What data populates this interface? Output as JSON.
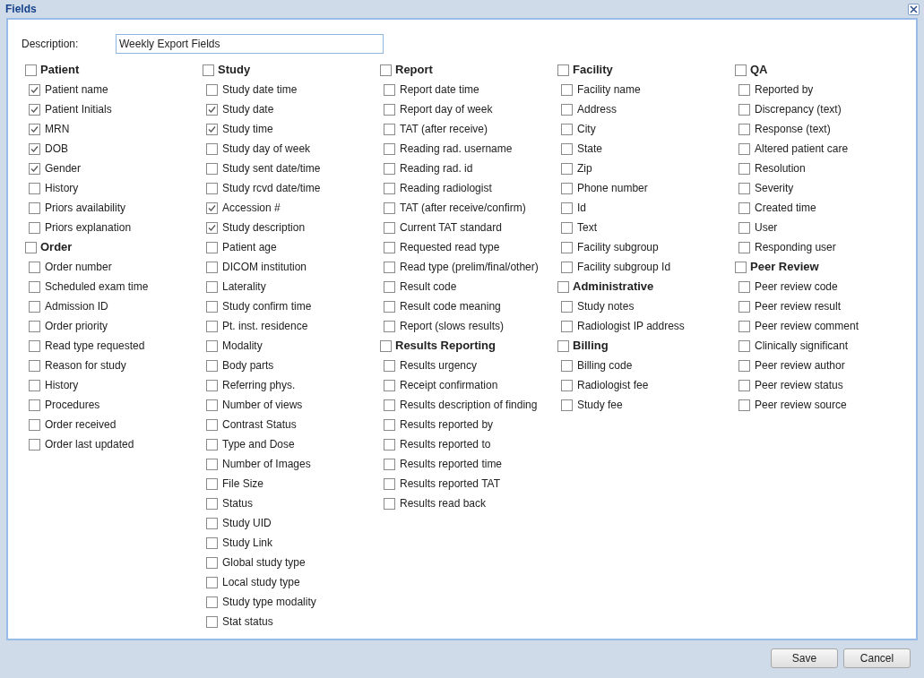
{
  "window": {
    "title": "Fields"
  },
  "description": {
    "label": "Description:",
    "value": "Weekly Export Fields"
  },
  "columns": [
    [
      {
        "title": "Patient",
        "checked": false,
        "items": [
          {
            "label": "Patient name",
            "checked": true
          },
          {
            "label": "Patient Initials",
            "checked": true
          },
          {
            "label": "MRN",
            "checked": true
          },
          {
            "label": "DOB",
            "checked": true
          },
          {
            "label": "Gender",
            "checked": true
          },
          {
            "label": "History",
            "checked": false
          },
          {
            "label": "Priors availability",
            "checked": false
          },
          {
            "label": "Priors explanation",
            "checked": false
          }
        ]
      },
      {
        "title": "Order",
        "checked": false,
        "items": [
          {
            "label": "Order number",
            "checked": false
          },
          {
            "label": "Scheduled exam time",
            "checked": false
          },
          {
            "label": "Admission ID",
            "checked": false
          },
          {
            "label": "Order priority",
            "checked": false
          },
          {
            "label": "Read type requested",
            "checked": false
          },
          {
            "label": "Reason for study",
            "checked": false
          },
          {
            "label": "History",
            "checked": false
          },
          {
            "label": "Procedures",
            "checked": false
          },
          {
            "label": "Order received",
            "checked": false
          },
          {
            "label": "Order last updated",
            "checked": false
          }
        ]
      }
    ],
    [
      {
        "title": "Study",
        "checked": false,
        "items": [
          {
            "label": "Study date time",
            "checked": false
          },
          {
            "label": "Study date",
            "checked": true
          },
          {
            "label": "Study time",
            "checked": true
          },
          {
            "label": "Study day of week",
            "checked": false
          },
          {
            "label": "Study sent date/time",
            "checked": false
          },
          {
            "label": "Study rcvd date/time",
            "checked": false
          },
          {
            "label": "Accession #",
            "checked": true
          },
          {
            "label": "Study description",
            "checked": true
          },
          {
            "label": "Patient age",
            "checked": false
          },
          {
            "label": "DICOM institution",
            "checked": false
          },
          {
            "label": "Laterality",
            "checked": false
          },
          {
            "label": "Study confirm time",
            "checked": false
          },
          {
            "label": "Pt. inst. residence",
            "checked": false
          },
          {
            "label": "Modality",
            "checked": false
          },
          {
            "label": "Body parts",
            "checked": false
          },
          {
            "label": "Referring phys.",
            "checked": false
          },
          {
            "label": "Number of views",
            "checked": false
          },
          {
            "label": "Contrast Status",
            "checked": false
          },
          {
            "label": "Type and Dose",
            "checked": false
          },
          {
            "label": "Number of Images",
            "checked": false
          },
          {
            "label": "File Size",
            "checked": false
          },
          {
            "label": "Status",
            "checked": false
          },
          {
            "label": "Study UID",
            "checked": false
          },
          {
            "label": "Study Link",
            "checked": false
          },
          {
            "label": "Global study type",
            "checked": false
          },
          {
            "label": "Local study type",
            "checked": false
          },
          {
            "label": "Study type modality",
            "checked": false
          },
          {
            "label": "Stat status",
            "checked": false
          }
        ]
      }
    ],
    [
      {
        "title": "Report",
        "checked": false,
        "items": [
          {
            "label": "Report date time",
            "checked": false
          },
          {
            "label": "Report day of week",
            "checked": false
          },
          {
            "label": "TAT (after receive)",
            "checked": false
          },
          {
            "label": "Reading rad. username",
            "checked": false
          },
          {
            "label": "Reading rad. id",
            "checked": false
          },
          {
            "label": "Reading radiologist",
            "checked": false
          },
          {
            "label": "TAT (after receive/confirm)",
            "checked": false
          },
          {
            "label": "Current TAT standard",
            "checked": false
          },
          {
            "label": "Requested read type",
            "checked": false
          },
          {
            "label": "Read type (prelim/final/other)",
            "checked": false
          },
          {
            "label": "Result code",
            "checked": false
          },
          {
            "label": "Result code meaning",
            "checked": false
          },
          {
            "label": "Report (slows results)",
            "checked": false
          }
        ]
      },
      {
        "title": "Results Reporting",
        "checked": false,
        "items": [
          {
            "label": "Results urgency",
            "checked": false
          },
          {
            "label": "Receipt confirmation",
            "checked": false
          },
          {
            "label": "Results description of finding",
            "checked": false
          },
          {
            "label": "Results reported by",
            "checked": false
          },
          {
            "label": "Results reported to",
            "checked": false
          },
          {
            "label": "Results reported time",
            "checked": false
          },
          {
            "label": "Results reported TAT",
            "checked": false
          },
          {
            "label": "Results read back",
            "checked": false
          }
        ]
      }
    ],
    [
      {
        "title": "Facility",
        "checked": false,
        "items": [
          {
            "label": "Facility name",
            "checked": false
          },
          {
            "label": "Address",
            "checked": false
          },
          {
            "label": "City",
            "checked": false
          },
          {
            "label": "State",
            "checked": false
          },
          {
            "label": "Zip",
            "checked": false
          },
          {
            "label": "Phone number",
            "checked": false
          },
          {
            "label": "Id",
            "checked": false
          },
          {
            "label": "Text",
            "checked": false
          },
          {
            "label": "Facility subgroup",
            "checked": false
          },
          {
            "label": "Facility subgroup Id",
            "checked": false
          }
        ]
      },
      {
        "title": "Administrative",
        "checked": false,
        "items": [
          {
            "label": "Study notes",
            "checked": false
          },
          {
            "label": "Radiologist IP address",
            "checked": false
          }
        ]
      },
      {
        "title": "Billing",
        "checked": false,
        "items": [
          {
            "label": "Billing code",
            "checked": false
          },
          {
            "label": "Radiologist fee",
            "checked": false
          },
          {
            "label": "Study fee",
            "checked": false
          }
        ]
      }
    ],
    [
      {
        "title": "QA",
        "checked": false,
        "items": [
          {
            "label": "Reported by",
            "checked": false
          },
          {
            "label": "Discrepancy (text)",
            "checked": false
          },
          {
            "label": "Response (text)",
            "checked": false
          },
          {
            "label": "Altered patient care",
            "checked": false
          },
          {
            "label": "Resolution",
            "checked": false
          },
          {
            "label": "Severity",
            "checked": false
          },
          {
            "label": "Created time",
            "checked": false
          },
          {
            "label": "User",
            "checked": false
          },
          {
            "label": "Responding user",
            "checked": false
          }
        ]
      },
      {
        "title": "Peer Review",
        "checked": false,
        "items": [
          {
            "label": "Peer review code",
            "checked": false
          },
          {
            "label": "Peer review result",
            "checked": false
          },
          {
            "label": "Peer review comment",
            "checked": false
          },
          {
            "label": "Clinically significant",
            "checked": false
          },
          {
            "label": "Peer review author",
            "checked": false
          },
          {
            "label": "Peer review status",
            "checked": false
          },
          {
            "label": "Peer review source",
            "checked": false
          }
        ]
      }
    ]
  ],
  "buttons": [
    "Save",
    "Cancel"
  ]
}
